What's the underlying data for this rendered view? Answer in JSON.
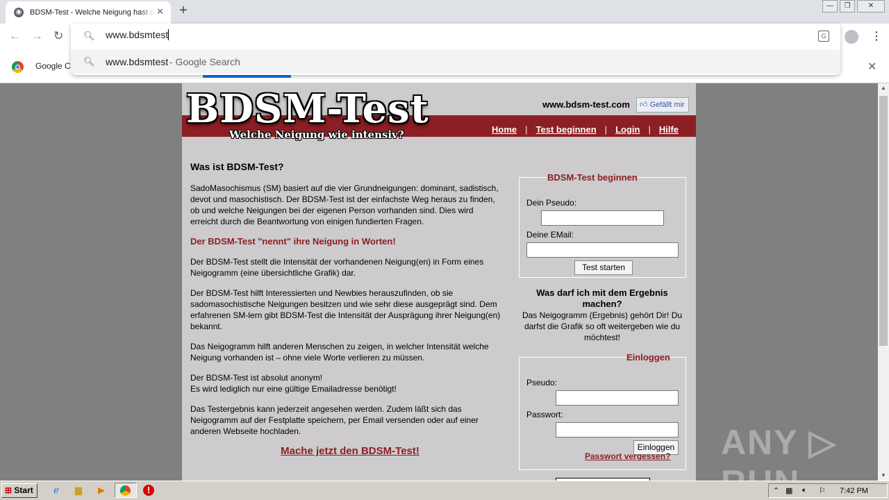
{
  "browser": {
    "tab_title": "BDSM-Test - Welche Neigung hast du?",
    "tab_close": "✕",
    "new_tab": "+",
    "address_value": "www.bdsmtest",
    "suggestion_text": "www.bdsmtest",
    "suggestion_suffix": " - Google Search",
    "bookmark_label": "Google Ch",
    "window_minimize": "—",
    "window_restore": "❐",
    "window_close": "✕",
    "infobar_close": "✕"
  },
  "site": {
    "logo": "BDSM-Test",
    "slogan": "Welche Neigung wie intensiv?",
    "url": "www.bdsm-test.com",
    "like": "Gefällt mir",
    "menu": [
      "Home",
      "Test beginnen",
      "Login",
      "Hilfe"
    ],
    "menu_sep": "|"
  },
  "content": {
    "heading": "Was ist BDSM-Test?",
    "p1": "SadoMasochismus (SM) basiert auf die vier Grundneigungen: dominant, sadistisch, devot und masochistisch. Der BDSM-Test ist der einfachste Weg heraus zu finden, ob und welche Neigungen bei der eigenen Person vorhanden sind. Dies wird erreicht durch die Beantwortung von einigen fundierten Fragen.",
    "highlight": "Der BDSM-Test \"nennt\" ihre Neigung in Worten!",
    "p2": "Der BDSM-Test stellt die Intensität der vorhandenen Neigung(en) in Form eines Neigogramm (eine übersichtliche Grafik) dar.",
    "p3": "Der BDSM-Test hilft Interessierten und Newbies herauszufinden, ob sie sadomasochistische Neigungen besitzen und wie sehr diese ausgeprägt sind. Dem erfahrenen SM-lern gibt BDSM-Test die Intensität der Ausprägung ihrer Neigung(en) bekannt.",
    "p4": "Das Neigogramm hilft anderen Menschen zu zeigen, in welcher Intensität welche Neigung vorhanden ist – ohne viele Worte verlieren zu müssen.",
    "p5a": "Der BDSM-Test ist absolut anonym!",
    "p5b": "Es wird lediglich nur eine gültige Emailadresse benötigt!",
    "p6": "Das Testergebnis kann jederzeit angesehen werden. Zudem läßt sich das Neigogramm auf der Festplatte speichern, per Email versenden oder auf einer anderen Webseite hochladen.",
    "cta": "Mache jetzt den BDSM-Test!"
  },
  "start_form": {
    "legend": "BDSM-Test beginnen",
    "pseudo_label": "Dein Pseudo:",
    "email_label": "Deine EMail:",
    "button": "Test starten"
  },
  "result": {
    "question": "Was darf ich mit dem Ergebnis machen?",
    "answer": "Das Neigogramm (Ergebnis) gehört Dir! Du darfst die Grafik so oft weitergeben wie du möchtest!"
  },
  "login_form": {
    "legend": "Einloggen",
    "pseudo_label": "Pseudo:",
    "password_label": "Passwort:",
    "button": "Einloggen",
    "forgot": "Passwort vergessen?"
  },
  "watermark": "ANY ▷ RUN",
  "taskbar": {
    "start": "Start",
    "time": "7:42 PM"
  }
}
